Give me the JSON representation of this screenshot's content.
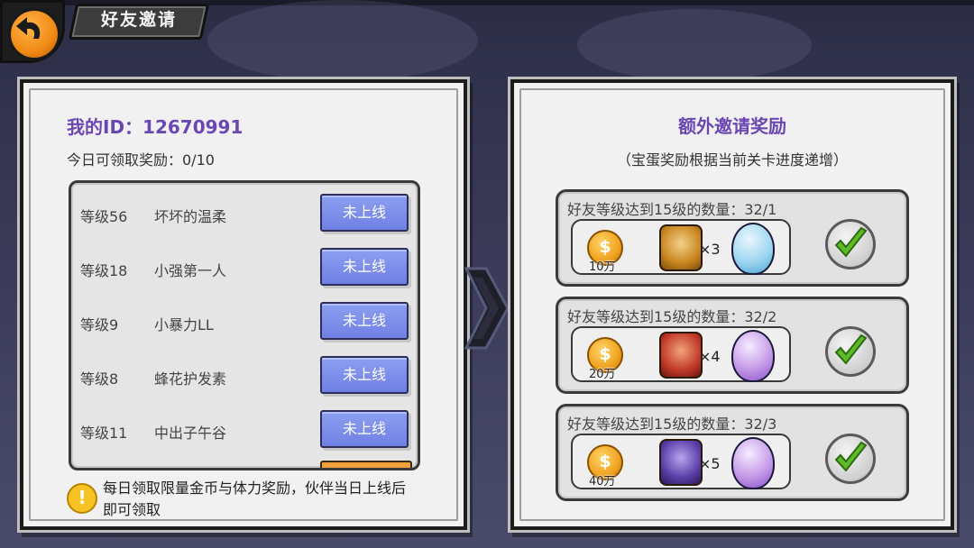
{
  "header": {
    "title": "好友邀请",
    "back_icon": "back-arrow-icon"
  },
  "left_panel": {
    "my_id_label": "我的ID：12670991",
    "today_rewards": "今日可领取奖励：0/10",
    "friends": [
      {
        "level": "等级56",
        "name": "坏坏的温柔",
        "status": "未上线"
      },
      {
        "level": "等级18",
        "name": "小强第一人",
        "status": "未上线"
      },
      {
        "level": "等级9",
        "name": "小暴力LL",
        "status": "未上线"
      },
      {
        "level": "等级8",
        "name": "蜂花护发素",
        "status": "未上线"
      },
      {
        "level": "等级11",
        "name": "中出子午谷",
        "status": "未上线"
      }
    ],
    "tip": "每日领取限量金币与体力奖励，伙伴当日上线后即可领取"
  },
  "right_panel": {
    "title": "额外邀请奖励",
    "subtitle": "（宝蛋奖励根据当前关卡进度递增）",
    "rewards": [
      {
        "condition": "好友等级达到15级的数量：32/1",
        "coin_symbol": "$",
        "coin_amount": "10万",
        "hero_count": "×3",
        "egg_color": "#9fd6f0"
      },
      {
        "condition": "好友等级达到15级的数量：32/2",
        "coin_symbol": "$",
        "coin_amount": "20万",
        "hero_count": "×4",
        "egg_color": "#c59ae8"
      },
      {
        "condition": "好友等级达到15级的数量：32/3",
        "coin_symbol": "$",
        "coin_amount": "40万",
        "hero_count": "×5",
        "egg_color": "#c59ae8"
      }
    ]
  },
  "colors": {
    "accent_purple": "#6b47b2",
    "button_blue": "#7b8ce8",
    "check_green": "#5dbb2a"
  }
}
